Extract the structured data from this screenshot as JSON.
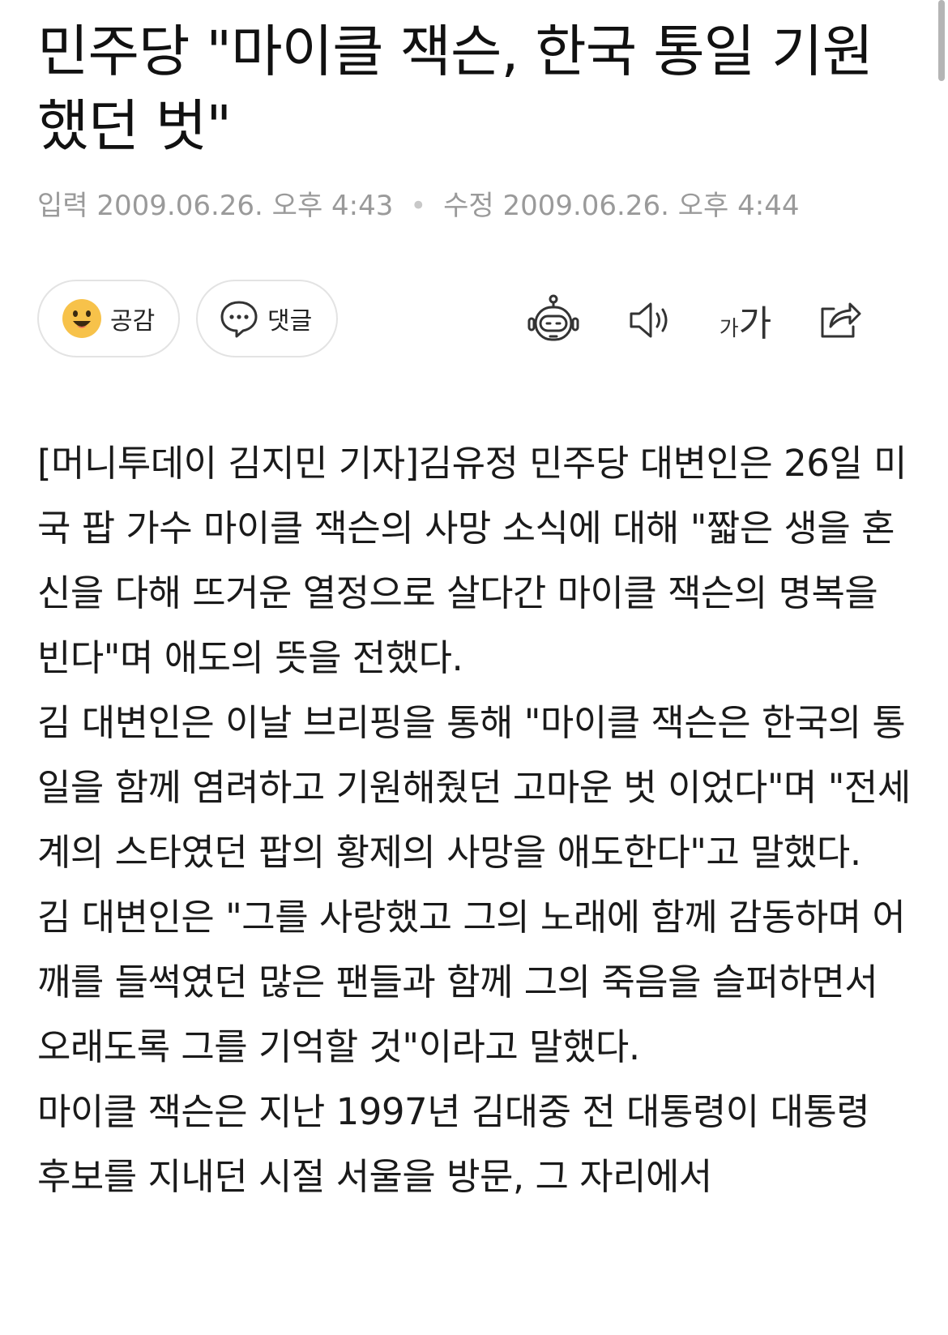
{
  "article": {
    "title": "민주당 \"마이클 잭슨, 한국 통일 기원했던 벗\"",
    "input_label": "입력",
    "input_time": "2009.06.26. 오후 4:43",
    "edit_label": "수정",
    "edit_time": "2009.06.26. 오후 4:44"
  },
  "toolbar": {
    "like_label": "공감",
    "comment_label": "댓글",
    "font_small": "가",
    "font_large": "가",
    "icons": [
      "smile-icon",
      "comment-bubble-icon",
      "robot-summary-icon",
      "speaker-icon",
      "font-size-icon",
      "share-icon"
    ]
  },
  "body": {
    "paragraphs": [
      "[머니투데이 김지민 기자]김유정 민주당 대변인은 26일 미국 팝 가수 마이클 잭슨의 사망 소식에 대해 \"짧은 생을 혼신을 다해 뜨거운 열정으로 살다간 마이클 잭슨의 명복을 빈다\"며 애도의 뜻을 전했다.",
      "김 대변인은 이날 브리핑을 통해 \"마이클 잭슨은 한국의 통일을 함께 염려하고 기원해줬던 고마운 벗 이었다\"며 \"전세계의 스타였던 팝의 황제의 사망을 애도한다\"고 말했다.",
      "김 대변인은 \"그를 사랑했고 그의 노래에 함께 감동하며 어깨를 들썩였던 많은 팬들과 함께 그의 죽음을 슬퍼하면서 오래도록 그를 기억할 것\"이라고 말했다.",
      "마이클 잭슨은 지난 1997년 김대중 전 대통령이 대통령 후보를 지내던 시절 서울을 방문, 그 자리에서"
    ]
  },
  "colors": {
    "meta_text": "#9a9a9a",
    "border": "#e3e3e3",
    "smiley_face": "#f7c24a"
  }
}
